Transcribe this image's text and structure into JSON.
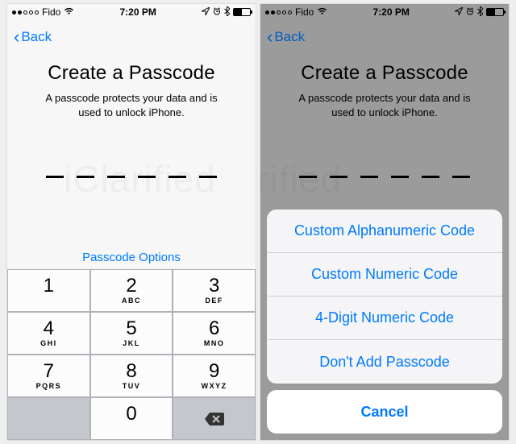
{
  "status": {
    "carrier": "Fido",
    "signal_filled": 2,
    "wifi": "wifi-icon",
    "time": "7:20 PM",
    "location": "location-icon",
    "alarm": "alarm-icon",
    "bluetooth": "bluetooth-icon",
    "battery_pct": 50
  },
  "nav": {
    "back": "Back"
  },
  "page": {
    "title": "Create a Passcode",
    "subtitle_line1": "A passcode protects your data and is",
    "subtitle_line2": "used to unlock iPhone.",
    "passcode_length": 6,
    "options_label": "Passcode Options"
  },
  "keypad": [
    [
      {
        "n": "1",
        "s": ""
      },
      {
        "n": "2",
        "s": "ABC"
      },
      {
        "n": "3",
        "s": "DEF"
      }
    ],
    [
      {
        "n": "4",
        "s": "GHI"
      },
      {
        "n": "5",
        "s": "JKL"
      },
      {
        "n": "6",
        "s": "MNO"
      }
    ],
    [
      {
        "n": "7",
        "s": "PQRS"
      },
      {
        "n": "8",
        "s": "TUV"
      },
      {
        "n": "9",
        "s": "WXYZ"
      }
    ],
    [
      {
        "n": "",
        "s": "",
        "blank": true
      },
      {
        "n": "0",
        "s": ""
      },
      {
        "n": "",
        "s": "",
        "del": true
      }
    ]
  ],
  "action_sheet": {
    "items": [
      "Custom Alphanumeric Code",
      "Custom Numeric Code",
      "4-Digit Numeric Code",
      "Don't Add Passcode"
    ],
    "cancel": "Cancel"
  },
  "watermark": "iClarified"
}
